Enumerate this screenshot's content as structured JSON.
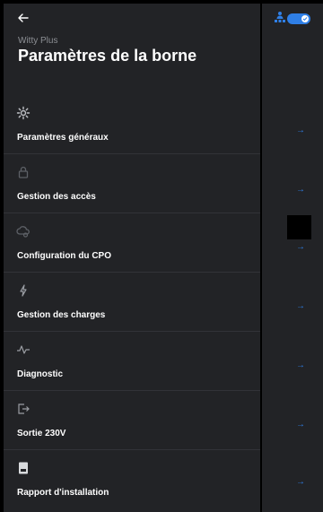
{
  "header": {
    "back_icon": "arrow-left-icon",
    "subtitle": "Witty Plus",
    "title": "Paramètres de la borne"
  },
  "status": {
    "user_icon": "user-network-icon",
    "toggle_on": true,
    "accent": "#2f7fe6"
  },
  "menu": [
    {
      "label": "Paramètres généraux",
      "icon": "gear-icon"
    },
    {
      "label": "Gestion des accès",
      "icon": "lock-icon"
    },
    {
      "label": "Configuration du CPO",
      "icon": "cloud-settings-icon"
    },
    {
      "label": "Gestion des charges",
      "icon": "lightning-icon"
    },
    {
      "label": "Diagnostic",
      "icon": "pulse-icon"
    },
    {
      "label": "Sortie 230V",
      "icon": "output-icon"
    },
    {
      "label": "Rapport d'installation",
      "icon": "document-icon"
    }
  ],
  "row_arrow": "→",
  "colors": {
    "background": "#222326",
    "accent": "#2f7fe6",
    "muted": "#8c8f94"
  }
}
